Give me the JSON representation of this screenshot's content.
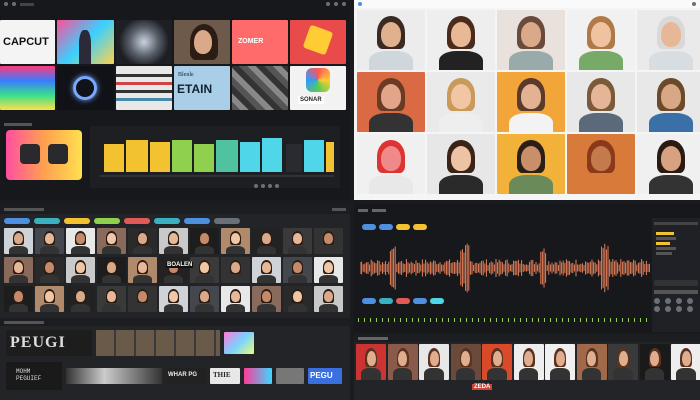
{
  "top_left": {
    "logo_text": "CAPCUT",
    "tile_enhance": "ETAIN",
    "tile_enhance_top": "Blenle",
    "tile_sonar": "SONAR",
    "tile_zomer": "ZOMER"
  },
  "bottom_left": {
    "row_text_1": "BOALEN",
    "strip_text_1": "PEUGI",
    "strip_text_2": "MOHM\nPEGUIEF",
    "strip_text_3": "WHAR PG",
    "strip_text_4": "THIE",
    "strip_text_5": "PEGU"
  },
  "right_bottom_strip": {
    "text": "ZEDA"
  },
  "colors": {
    "accent_blue": "#4f8fe0",
    "accent_yellow": "#f2c230",
    "accent_red": "#e05a5a",
    "waveform": "#e6805a"
  }
}
